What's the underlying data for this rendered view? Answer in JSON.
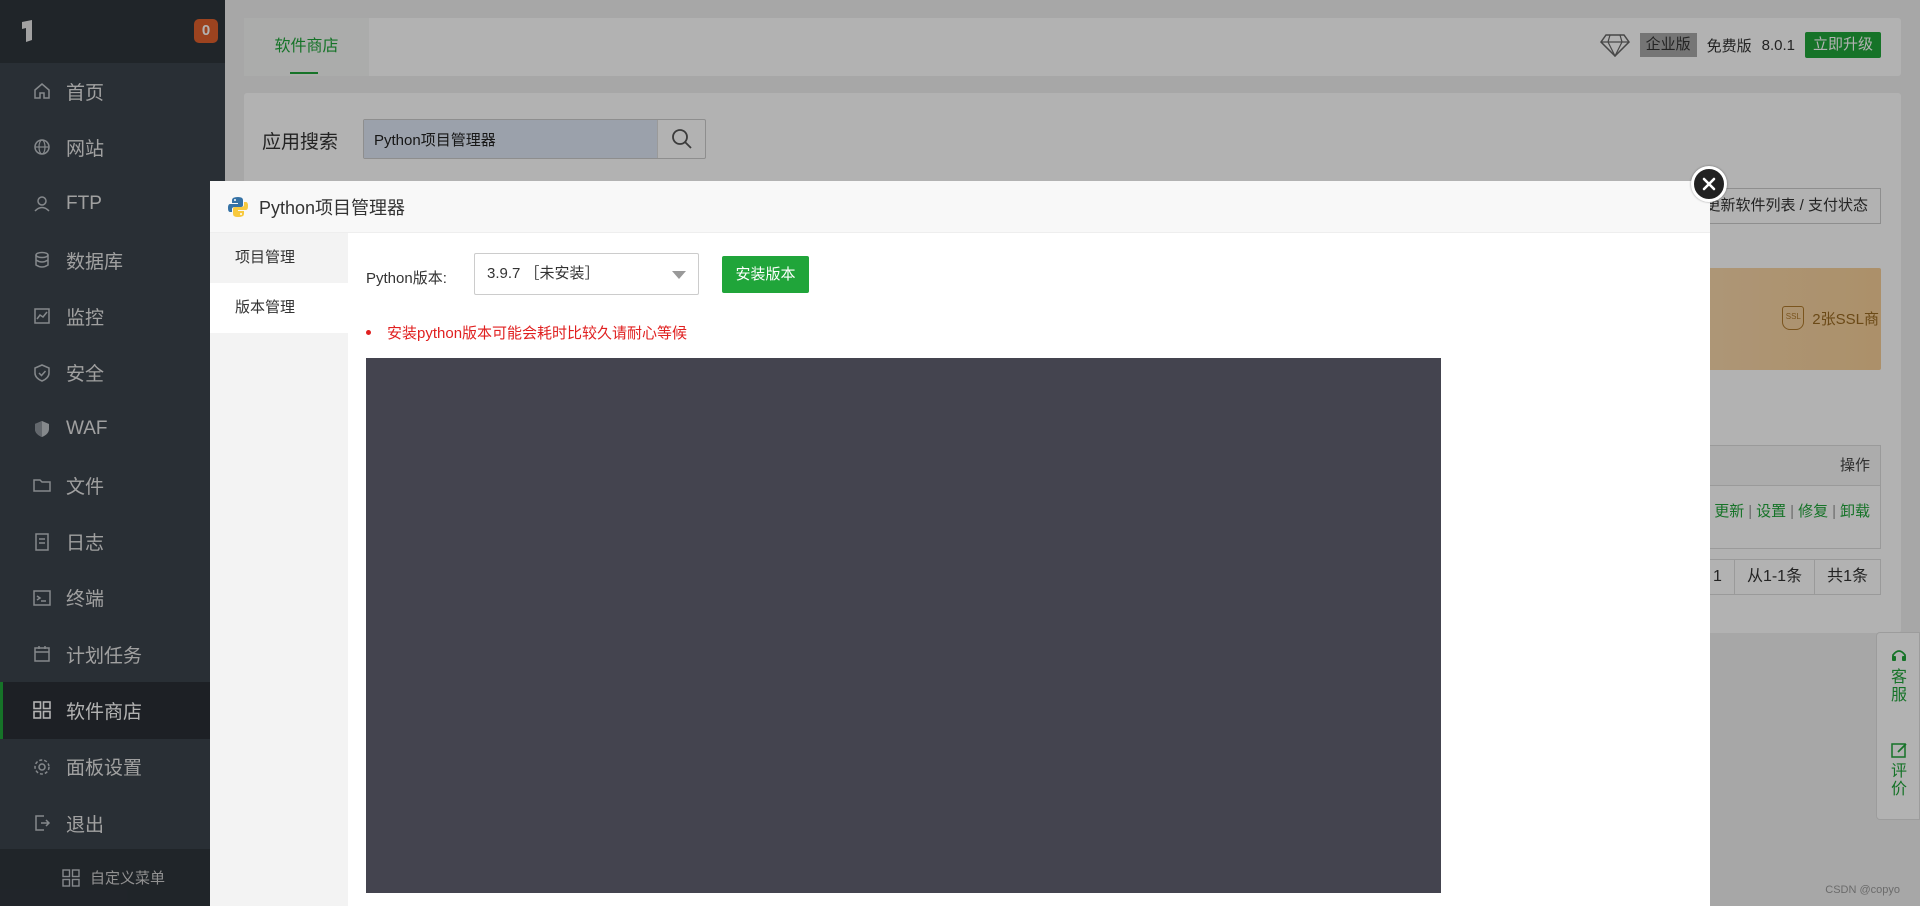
{
  "sidebar": {
    "badge": "0",
    "items": [
      {
        "label": "首页",
        "icon": "home-icon"
      },
      {
        "label": "网站",
        "icon": "globe-icon"
      },
      {
        "label": "FTP",
        "icon": "ftp-icon"
      },
      {
        "label": "数据库",
        "icon": "database-icon"
      },
      {
        "label": "监控",
        "icon": "monitor-icon"
      },
      {
        "label": "安全",
        "icon": "shield-icon"
      },
      {
        "label": "WAF",
        "icon": "waf-shield-icon"
      },
      {
        "label": "文件",
        "icon": "folder-icon"
      },
      {
        "label": "日志",
        "icon": "log-icon"
      },
      {
        "label": "终端",
        "icon": "terminal-icon"
      },
      {
        "label": "计划任务",
        "icon": "calendar-icon"
      },
      {
        "label": "软件商店",
        "icon": "apps-grid-icon"
      },
      {
        "label": "面板设置",
        "icon": "gear-icon"
      },
      {
        "label": "退出",
        "icon": "logout-icon"
      }
    ],
    "custom_menu": "自定义菜单"
  },
  "topbar": {
    "tab": "软件商店",
    "edition": "企业版",
    "free": "免费版",
    "version": "8.0.1",
    "upgrade": "立即升级"
  },
  "panel": {
    "search_label": "应用搜索",
    "search_value": "Python项目管理器",
    "update_btn": "更新软件列表 / 支付状态",
    "promo_left": ")",
    "promo_ssl": "2张SSL商",
    "ssl_icon_text": "SSL",
    "table_header": "操作",
    "actions": [
      "更新",
      "设置",
      "修复",
      "卸载"
    ],
    "pager": [
      "1",
      "从1-1条",
      "共1条"
    ]
  },
  "float_bar": {
    "service": [
      "客",
      "服"
    ],
    "review": [
      "评",
      "价"
    ]
  },
  "watermark": "CSDN @copyo",
  "dialog": {
    "title": "Python项目管理器",
    "tabs": [
      "项目管理",
      "版本管理"
    ],
    "version_label": "Python版本:",
    "version_value": "3.9.7 ［未安装］",
    "install_btn": "安装版本",
    "warning": "安装python版本可能会耗时比较久请耐心等候"
  },
  "colors": {
    "accent": "#20a53a",
    "sidebar_bg": "#3c444d",
    "badge": "#e0612d",
    "warning": "#e02020",
    "console_bg": "#44444f"
  }
}
